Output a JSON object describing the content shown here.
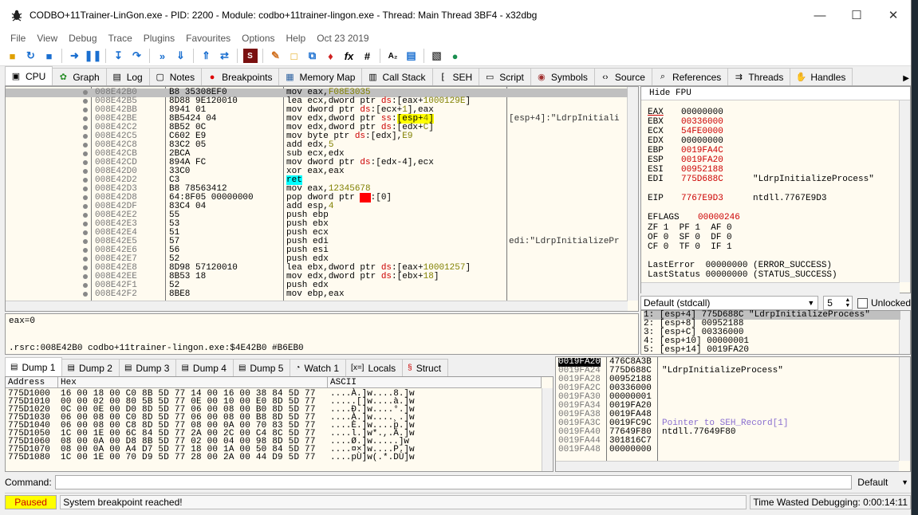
{
  "titlebar": {
    "title": "CODBO+11Trainer-LinGon.exe - PID: 2200 - Module: codbo+11trainer-lingon.exe - Thread: Main Thread 3BF4 - x32dbg"
  },
  "menu": [
    "File",
    "View",
    "Debug",
    "Trace",
    "Plugins",
    "Favourites",
    "Options",
    "Help",
    "Oct 23 2019"
  ],
  "tabs": [
    {
      "label": "CPU",
      "icon": "cpu-icon"
    },
    {
      "label": "Graph",
      "icon": "graph-icon"
    },
    {
      "label": "Log",
      "icon": "log-icon"
    },
    {
      "label": "Notes",
      "icon": "notes-icon"
    },
    {
      "label": "Breakpoints",
      "icon": "breakpoint-icon"
    },
    {
      "label": "Memory Map",
      "icon": "memory-map-icon"
    },
    {
      "label": "Call Stack",
      "icon": "call-stack-icon"
    },
    {
      "label": "SEH",
      "icon": "seh-icon"
    },
    {
      "label": "Script",
      "icon": "script-icon"
    },
    {
      "label": "Symbols",
      "icon": "symbols-icon"
    },
    {
      "label": "Source",
      "icon": "source-icon"
    },
    {
      "label": "References",
      "icon": "references-icon"
    },
    {
      "label": "Threads",
      "icon": "threads-icon"
    },
    {
      "label": "Handles",
      "icon": "handles-icon"
    }
  ],
  "disasm": [
    {
      "addr": "008E42B0",
      "bytes": "B8 35308EF0",
      "dis": "mov eax,F08E3035",
      "cmt": ""
    },
    {
      "addr": "008E42B5",
      "bytes": "8D88 9E120010",
      "dis": "lea ecx,dword ptr ds:[eax+1000129E]",
      "cmt": ""
    },
    {
      "addr": "008E42BB",
      "bytes": "8941 01",
      "dis": "mov dword ptr ds:[ecx+1],eax",
      "cmt": ""
    },
    {
      "addr": "008E42BE",
      "bytes": "8B5424 04",
      "dis": "mov edx,dword ptr ss:[esp+4]",
      "cmt": "[esp+4]:\"LdrpInitiali"
    },
    {
      "addr": "008E42C2",
      "bytes": "8B52 0C",
      "dis": "mov edx,dword ptr ds:[edx+C]",
      "cmt": ""
    },
    {
      "addr": "008E42C5",
      "bytes": "C602 E9",
      "dis": "mov byte ptr ds:[edx],E9",
      "cmt": ""
    },
    {
      "addr": "008E42C8",
      "bytes": "83C2 05",
      "dis": "add edx,5",
      "cmt": ""
    },
    {
      "addr": "008E42CB",
      "bytes": "2BCA",
      "dis": "sub ecx,edx",
      "cmt": ""
    },
    {
      "addr": "008E42CD",
      "bytes": "894A FC",
      "dis": "mov dword ptr ds:[edx-4],ecx",
      "cmt": ""
    },
    {
      "addr": "008E42D0",
      "bytes": "33C0",
      "dis": "xor eax,eax",
      "cmt": ""
    },
    {
      "addr": "008E42D2",
      "bytes": "C3",
      "dis": "ret",
      "cmt": ""
    },
    {
      "addr": "008E42D3",
      "bytes": "B8 78563412",
      "dis": "mov eax,12345678",
      "cmt": ""
    },
    {
      "addr": "008E42D8",
      "bytes": "64:8F05 00000000",
      "dis": "pop dword ptr fs:[0]",
      "cmt": ""
    },
    {
      "addr": "008E42DF",
      "bytes": "83C4 04",
      "dis": "add esp,4",
      "cmt": ""
    },
    {
      "addr": "008E42E2",
      "bytes": "55",
      "dis": "push ebp",
      "cmt": ""
    },
    {
      "addr": "008E42E3",
      "bytes": "53",
      "dis": "push ebx",
      "cmt": ""
    },
    {
      "addr": "008E42E4",
      "bytes": "51",
      "dis": "push ecx",
      "cmt": ""
    },
    {
      "addr": "008E42E5",
      "bytes": "57",
      "dis": "push edi",
      "cmt": "edi:\"LdrpInitializePr"
    },
    {
      "addr": "008E42E6",
      "bytes": "56",
      "dis": "push esi",
      "cmt": ""
    },
    {
      "addr": "008E42E7",
      "bytes": "52",
      "dis": "push edx",
      "cmt": ""
    },
    {
      "addr": "008E42E8",
      "bytes": "8D98 57120010",
      "dis": "lea ebx,dword ptr ds:[eax+10001257]",
      "cmt": ""
    },
    {
      "addr": "008E42EE",
      "bytes": "8B53 18",
      "dis": "mov edx,dword ptr ds:[ebx+18]",
      "cmt": ""
    },
    {
      "addr": "008E42F1",
      "bytes": "52",
      "dis": "push edx",
      "cmt": ""
    },
    {
      "addr": "008E42F2",
      "bytes": "8BE8",
      "dis": "mov ebp,eax",
      "cmt": ""
    }
  ],
  "regs": {
    "header": "Hide FPU",
    "lines": [
      {
        "name": "EAX",
        "val": "00000000",
        "extra": "",
        "changed": false
      },
      {
        "name": "EBX",
        "val": "00336000",
        "extra": "",
        "changed": true
      },
      {
        "name": "ECX",
        "val": "54FE0000",
        "extra": "",
        "changed": true
      },
      {
        "name": "EDX",
        "val": "00000000",
        "extra": "",
        "changed": false
      },
      {
        "name": "EBP",
        "val": "0019FA4C",
        "extra": "",
        "changed": true
      },
      {
        "name": "ESP",
        "val": "0019FA20",
        "extra": "",
        "changed": true
      },
      {
        "name": "ESI",
        "val": "00952188",
        "extra": "",
        "changed": true
      },
      {
        "name": "EDI",
        "val": "775D688C",
        "extra": "\"LdrpInitializeProcess\"",
        "changed": true
      }
    ],
    "eip": {
      "name": "EIP",
      "val": "7767E9D3",
      "extra": "ntdll.7767E9D3"
    },
    "eflags": {
      "name": "EFLAGS",
      "val": "00000246"
    },
    "flags": [
      "ZF 1  PF 1  AF 0",
      "OF 0  SF 0  DF 0",
      "CF 0  TF 0  IF 1"
    ],
    "lasterror": "LastError  00000000 (ERROR_SUCCESS)",
    "laststatus": "LastStatus 00000000 (STATUS_SUCCESS)"
  },
  "callconv": {
    "label": "Default (stdcall)",
    "count": "5",
    "unlocked": "Unlocked"
  },
  "stackargs": [
    "1: [esp+4] 775D688C \"LdrpInitializeProcess\"",
    "2: [esp+8] 00952188",
    "3: [esp+C] 00336000",
    "4: [esp+10] 00000001",
    "5: [esp+14] 0019FA20"
  ],
  "info": {
    "line1": "eax=0",
    "line2": ".rsrc:008E42B0 codbo+11trainer-lingon.exe:$4E42B0 #B6EB0"
  },
  "dumptabs": [
    {
      "label": "Dump 1",
      "icon": "dump-icon"
    },
    {
      "label": "Dump 2",
      "icon": "dump-icon"
    },
    {
      "label": "Dump 3",
      "icon": "dump-icon"
    },
    {
      "label": "Dump 4",
      "icon": "dump-icon"
    },
    {
      "label": "Dump 5",
      "icon": "dump-icon"
    },
    {
      "label": "Watch 1",
      "icon": "watch-icon"
    },
    {
      "label": "Locals",
      "icon": "locals-icon"
    },
    {
      "label": "Struct",
      "icon": "struct-icon"
    }
  ],
  "dump": {
    "headers": [
      "Address",
      "Hex",
      "ASCII"
    ],
    "rows": [
      {
        "addr": "775D1000",
        "hex": "16 00 18 00 C0 8B 5D 77 14 00 16 00 38 84 5D 77",
        "ascii": "....À.]w....8.]w"
      },
      {
        "addr": "775D1010",
        "hex": "00 00 02 00 80 5B 5D 77 0E 00 10 00 E0 8D 5D 77",
        "ascii": ".....[]w....à.]w"
      },
      {
        "addr": "775D1020",
        "hex": "0C 00 0E 00 D0 8D 5D 77 06 00 08 00 B0 8D 5D 77",
        "ascii": "....Ð.]w....°.]w"
      },
      {
        "addr": "775D1030",
        "hex": "06 00 08 00 C0 8D 5D 77 06 00 08 00 B8 8D 5D 77",
        "ascii": "....À.]w....¸.]w"
      },
      {
        "addr": "775D1040",
        "hex": "06 00 08 00 C8 8D 5D 77 08 00 0A 00 70 83 5D 77",
        "ascii": "....È.]w....p.]w"
      },
      {
        "addr": "775D1050",
        "hex": "1C 00 1E 00 6C 84 5D 77 2A 00 2C 00 C4 8C 5D 77",
        "ascii": "....l.]w*.,.Ä.]w"
      },
      {
        "addr": "775D1060",
        "hex": "08 00 0A 00 D8 8B 5D 77 02 00 04 00 98 8D 5D 77",
        "ascii": "....Ø.]w.....]w"
      },
      {
        "addr": "775D1070",
        "hex": "08 00 0A 00 A4 D7 5D 77 18 00 1A 00 50 84 5D 77",
        "ascii": "....¤×]w....P.]w"
      },
      {
        "addr": "775D1080",
        "hex": "1C 00 1E 00 70 D9 5D 77 28 00 2A 00 44 D9 5D 77",
        "ascii": "....pÙ]w(.*.DÙ]w"
      }
    ]
  },
  "stack": [
    {
      "addr": "0019FA20",
      "val": "476C8A3B",
      "cmt": "",
      "sel": true
    },
    {
      "addr": "0019FA24",
      "val": "775D688C",
      "cmt": "\"LdrpInitializeProcess\"",
      "sel": false
    },
    {
      "addr": "0019FA28",
      "val": "00952188",
      "cmt": "",
      "sel": false
    },
    {
      "addr": "0019FA2C",
      "val": "00336000",
      "cmt": "",
      "sel": false
    },
    {
      "addr": "0019FA30",
      "val": "00000001",
      "cmt": "",
      "sel": false
    },
    {
      "addr": "0019FA34",
      "val": "0019FA20",
      "cmt": "",
      "sel": false
    },
    {
      "addr": "0019FA38",
      "val": "0019FA48",
      "cmt": "",
      "sel": false
    },
    {
      "addr": "0019FA3C",
      "val": "0019FC9C",
      "cmt": "Pointer to SEH_Record[1]",
      "sel": false
    },
    {
      "addr": "0019FA40",
      "val": "77649F80",
      "cmt": "ntdll.77649F80",
      "sel": false
    },
    {
      "addr": "0019FA44",
      "val": "301816C7",
      "cmt": "",
      "sel": false
    },
    {
      "addr": "0019FA48",
      "val": "00000000",
      "cmt": "",
      "sel": false
    }
  ],
  "command": {
    "label": "Command:",
    "value": "",
    "default": "Default"
  },
  "status": {
    "state": "Paused",
    "message": "System breakpoint reached!",
    "time": "Time Wasted Debugging: 0:00:14:11"
  },
  "colors": {
    "paused": "#ffff00",
    "selection": "#c0c0c0",
    "accent": "#c00000"
  }
}
